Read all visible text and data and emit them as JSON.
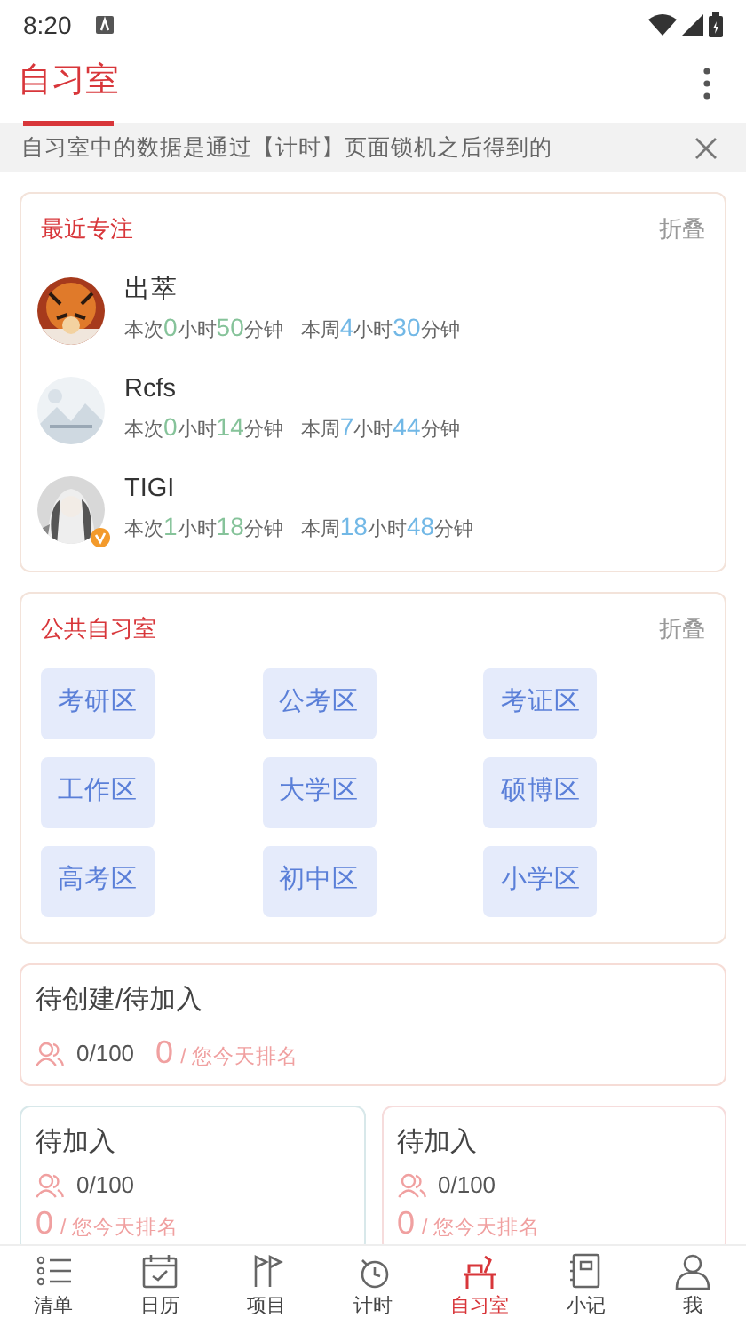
{
  "status_bar": {
    "time": "8:20"
  },
  "header": {
    "title": "自习室",
    "selected": true
  },
  "notice": {
    "text": "自习室中的数据是通过【计时】页面锁机之后得到的"
  },
  "recent_focus": {
    "title": "最近专注",
    "collapse": "折叠",
    "entries": [
      {
        "name": "出萃",
        "badge": false,
        "session": {
          "label": "本次",
          "hours": "0",
          "hours_unit": "小时",
          "minutes": "50",
          "minutes_unit": "分钟"
        },
        "week": {
          "label": "本周",
          "hours": "4",
          "hours_unit": "小时",
          "minutes": "30",
          "minutes_unit": "分钟"
        }
      },
      {
        "name": "Rcfs",
        "badge": false,
        "session": {
          "label": "本次",
          "hours": "0",
          "hours_unit": "小时",
          "minutes": "14",
          "minutes_unit": "分钟"
        },
        "week": {
          "label": "本周",
          "hours": "7",
          "hours_unit": "小时",
          "minutes": "44",
          "minutes_unit": "分钟"
        }
      },
      {
        "name": "TIGI",
        "badge": true,
        "session": {
          "label": "本次",
          "hours": "1",
          "hours_unit": "小时",
          "minutes": "18",
          "minutes_unit": "分钟"
        },
        "week": {
          "label": "本周",
          "hours": "18",
          "hours_unit": "小时",
          "minutes": "48",
          "minutes_unit": "分钟"
        }
      }
    ]
  },
  "public_rooms": {
    "title": "公共自习室",
    "collapse": "折叠",
    "rooms": [
      "考研区",
      "公考区",
      "考证区",
      "工作区",
      "大学区",
      "硕博区",
      "高考区",
      "初中区",
      "小学区"
    ]
  },
  "rooms": [
    {
      "title": "待创建/待加入",
      "members": "0/100",
      "rank": "0",
      "rank_label": "/ 您今天排名",
      "color": "#f6dcd6"
    },
    {
      "title": "待加入",
      "members": "0/100",
      "rank": "0",
      "rank_label": "/ 您今天排名",
      "color": "#d8e8ea"
    },
    {
      "title": "待加入",
      "members": "0/100",
      "rank": "0",
      "rank_label": "/ 您今天排名",
      "color": "#f6dcdc"
    }
  ],
  "nav": [
    {
      "kind": "list",
      "label": "清单",
      "selected": false
    },
    {
      "kind": "calendar",
      "label": "日历",
      "selected": false
    },
    {
      "kind": "flag",
      "label": "项目",
      "selected": false
    },
    {
      "kind": "timer",
      "label": "计时",
      "selected": false
    },
    {
      "kind": "desk",
      "label": "自习室",
      "selected": true
    },
    {
      "kind": "notebook",
      "label": "小记",
      "selected": false
    },
    {
      "kind": "person",
      "label": "我",
      "selected": false
    }
  ]
}
